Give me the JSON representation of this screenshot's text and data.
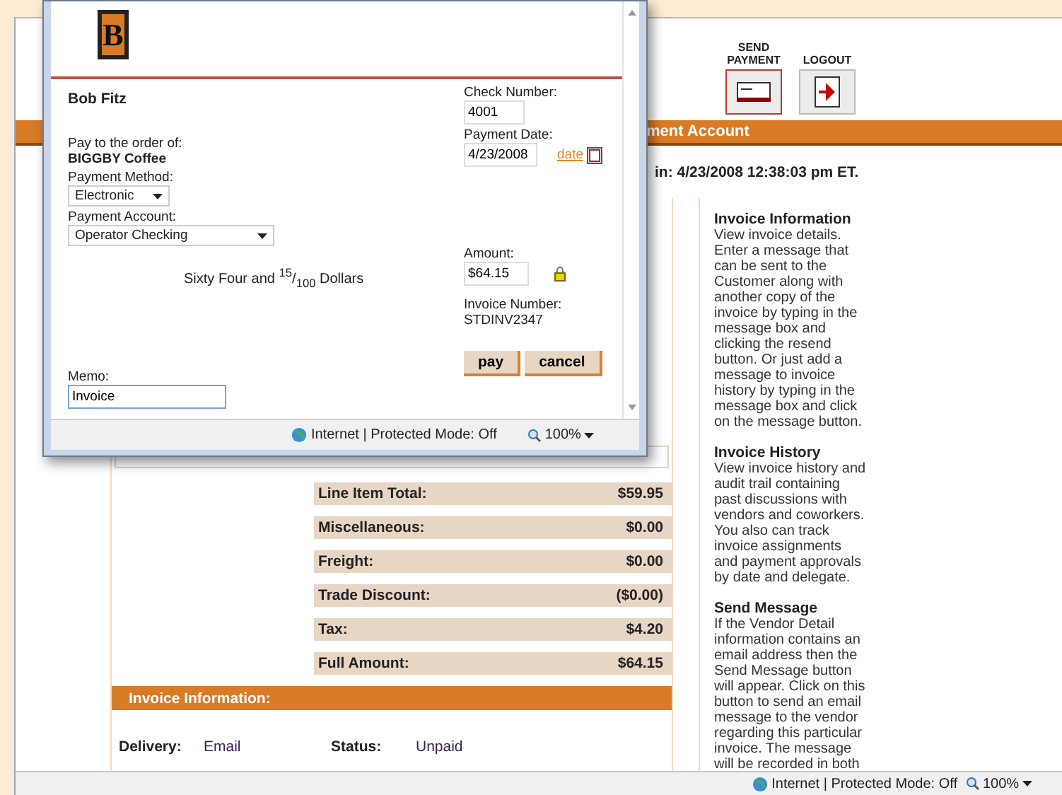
{
  "page": {
    "header_buttons": [
      {
        "label": "SEND PAYMENT",
        "kind": "send",
        "selected": true
      },
      {
        "label": "LOGOUT",
        "kind": "logout",
        "selected": false
      }
    ],
    "section_bar": "ment Account",
    "login_line": "in: 4/23/2008 12:38:03 pm ET.",
    "totals": [
      {
        "label": "Line Item Total:",
        "value": "$59.95"
      },
      {
        "label": "Miscellaneous:",
        "value": "$0.00"
      },
      {
        "label": "Freight:",
        "value": "$0.00"
      },
      {
        "label": "Trade Discount:",
        "value": "($0.00)"
      },
      {
        "label": "Tax:",
        "value": "$4.20"
      },
      {
        "label": "Full Amount:",
        "value": "$64.15"
      }
    ],
    "invoice_info": {
      "title": "Invoice Information:",
      "fields": [
        {
          "label": "Delivery:",
          "value": "Email"
        },
        {
          "label": "Status:",
          "value": "Unpaid"
        }
      ]
    },
    "help": [
      {
        "title": "Invoice Information",
        "text": "View invoice details. Enter a message that can be sent to the Customer along with another copy of the invoice by typing in the message box and clicking the resend button. Or just add a message to invoice history by typing in the message box and click on the message button."
      },
      {
        "title": "Invoice History",
        "text": "View invoice history and audit trail containing past discussions with vendors and coworkers. You also can track invoice assignments and payment approvals by date and delegate."
      },
      {
        "title": "Send Message",
        "text": "If the Vendor Detail information contains an email address then the Send Message button will appear. Click on this button to send an email message to the vendor regarding this particular invoice. The message will be recorded in both"
      }
    ]
  },
  "popup": {
    "logo": "B",
    "payer": "Bob Fitz",
    "pay_to_label": "Pay to the order of:",
    "payee": "BIGGBY Coffee",
    "method_label": "Payment Method:",
    "method": "Electronic",
    "account_label": "Payment Account:",
    "account": "Operator Checking",
    "amount_words": "Sixty Four and $^{15}$/$_{100}$ Dollars",
    "check_number_label": "Check Number:",
    "check_number": "4001",
    "payment_date_label": "Payment Date:",
    "payment_date": "4/23/2008",
    "date_link": "date",
    "amount_label": "Amount:",
    "amount": "$64.15",
    "invoice_number_label": "Invoice Number:",
    "invoice_number": "STDINV2347",
    "memo_label": "Memo:",
    "memo": "Invoice",
    "buttons": [
      "pay",
      "cancel"
    ],
    "status_bar": {
      "zone": "Internet | Protected Mode: Off",
      "zoom": "100%"
    }
  },
  "status_bar": {
    "zone": "Internet | Protected Mode: Off",
    "zoom": "100%"
  }
}
